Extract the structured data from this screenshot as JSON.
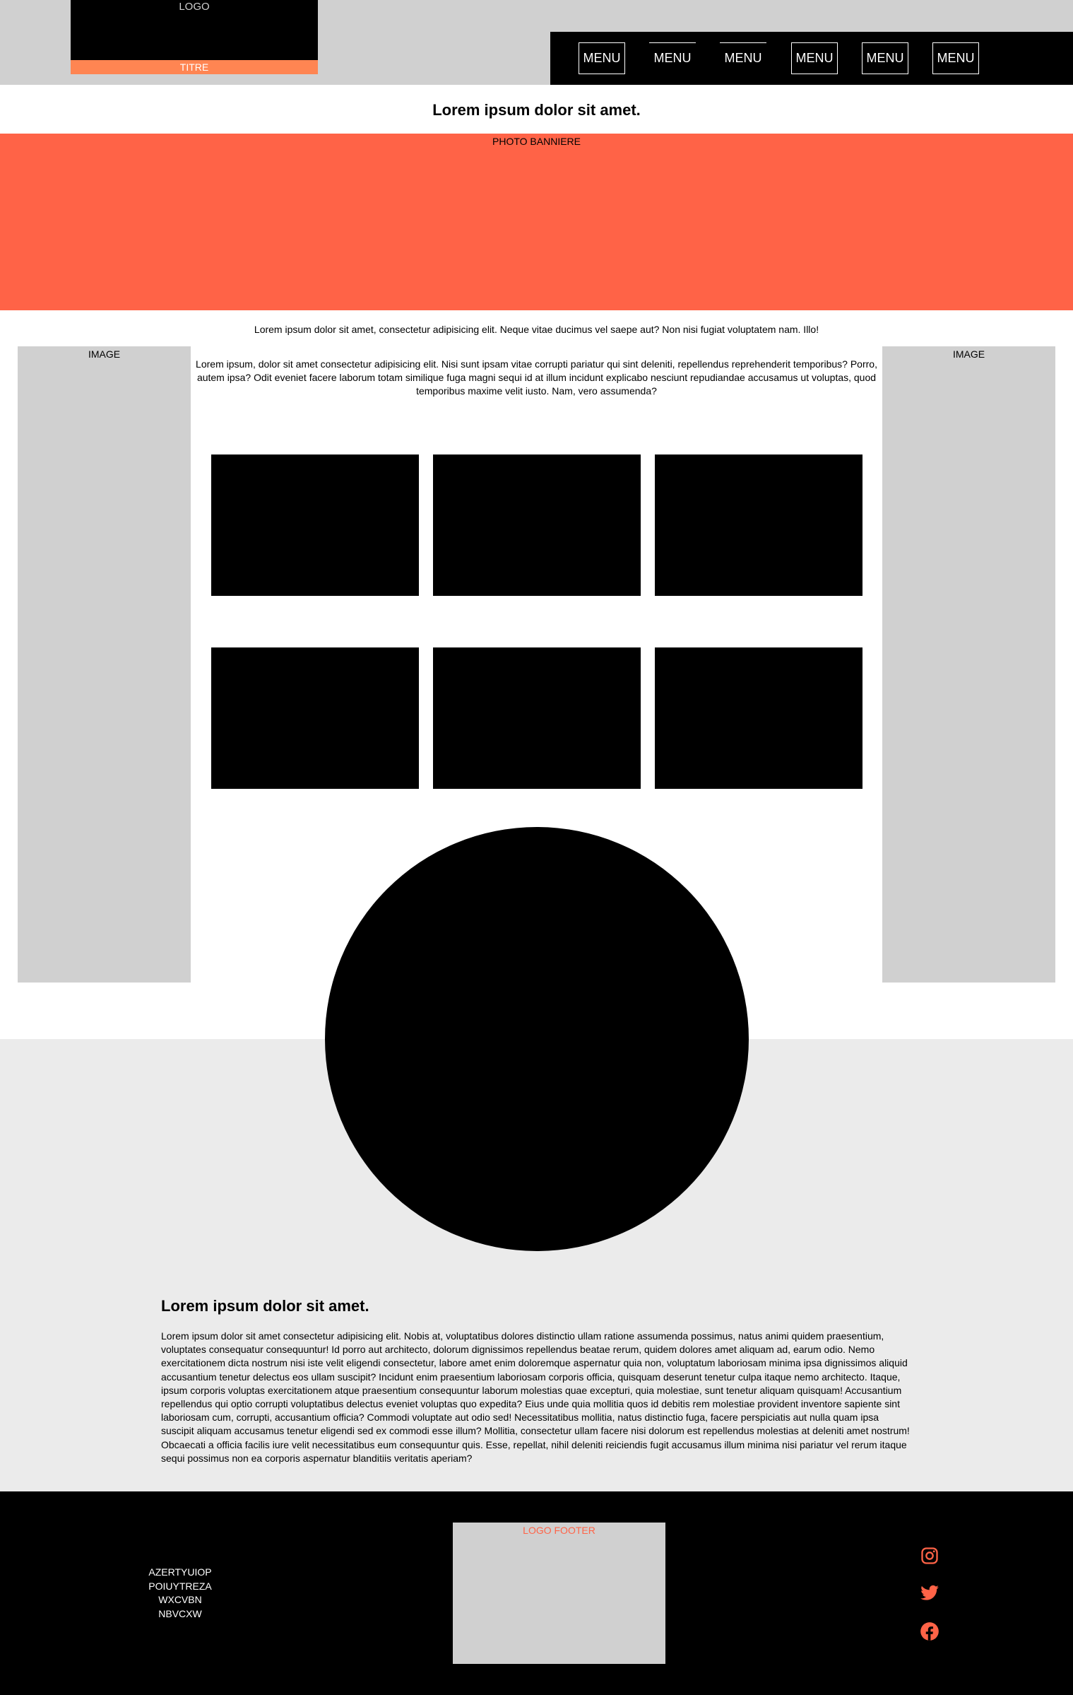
{
  "header": {
    "logo": "LOGO",
    "titre": "TITRE",
    "menu": [
      "MENU",
      "MENU",
      "MENU",
      "MENU",
      "MENU",
      "MENU"
    ]
  },
  "banner": {
    "title": "Lorem ipsum dolor sit amet.",
    "photo_label": "PHOTO BANNIERE"
  },
  "main": {
    "intro": "Lorem ipsum dolor sit amet, consectetur adipisicing elit. Neque vitae ducimus vel saepe aut? Non nisi fugiat voluptatem nam. Illo!",
    "side_left_label": "IMAGE",
    "side_right_label": "IMAGE",
    "center_text": "Lorem ipsum, dolor sit amet consectetur adipisicing elit. Nisi sunt ipsam vitae corrupti pariatur qui sint deleniti, repellendus reprehenderit temporibus? Porro, autem ipsa? Odit eveniet facere laborum totam similique fuga magni sequi id at illum incidunt explicabo nesciunt repudiandae accusamus ut voluptas, quod temporibus maxime velit iusto. Nam, vero assumenda?"
  },
  "section": {
    "title": "Lorem ipsum dolor sit amet.",
    "body": "Lorem ipsum dolor sit amet consectetur adipisicing elit. Nobis at, voluptatibus dolores distinctio ullam ratione assumenda possimus, natus animi quidem praesentium, voluptates consequatur consequuntur! Id porro aut architecto, dolorum dignissimos repellendus beatae rerum, quidem dolores amet aliquam ad, earum odio. Nemo exercitationem dicta nostrum nisi iste velit eligendi consectetur, labore amet enim doloremque aspernatur quia non, voluptatum laboriosam minima ipsa dignissimos aliquid accusantium tenetur delectus eos ullam suscipit? Incidunt enim praesentium laboriosam corporis officia, quisquam deserunt tenetur culpa itaque nemo architecto. Itaque, ipsum corporis voluptas exercitationem atque praesentium consequuntur laborum molestias quae excepturi, quia molestiae, sunt tenetur aliquam quisquam! Accusantium repellendus qui optio corrupti voluptatibus delectus eveniet voluptas quo expedita? Eius unde quia mollitia quos id debitis rem molestiae provident inventore sapiente sint laboriosam cum, corrupti, accusantium officia? Commodi voluptate aut odio sed! Necessitatibus mollitia, natus distinctio fuga, facere perspiciatis aut nulla quam ipsa suscipit aliquam accusamus tenetur eligendi sed ex commodi esse illum? Mollitia, consectetur ullam facere nisi dolorum est repellendus molestias at deleniti amet nostrum! Obcaecati a officia facilis iure velit necessitatibus eum consequuntur quis. Esse, repellat, nihil deleniti reiciendis fugit accusamus illum minima nisi pariatur vel rerum itaque sequi possimus non ea corporis aspernatur blanditiis veritatis aperiam?"
  },
  "footer": {
    "lines": [
      "AZERTYUIOP",
      "POIUYTREZA",
      "WXCVBN",
      "NBVCXW"
    ],
    "logo_label": "LOGO FOOTER",
    "social": [
      "instagram-icon",
      "twitter-icon",
      "facebook-icon"
    ]
  },
  "colors": {
    "accent": "#ff6347",
    "titre": "#ff8552",
    "header_gray": "#d0d0d0",
    "section_gray": "#ebebeb"
  }
}
